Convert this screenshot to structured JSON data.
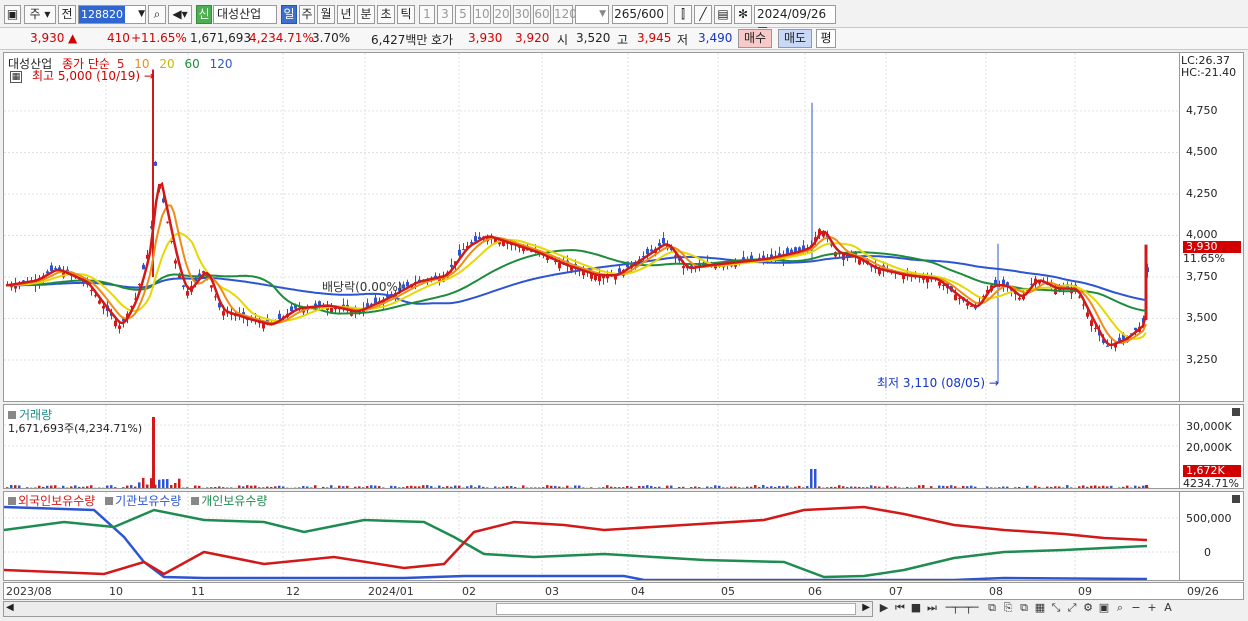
{
  "toolbar": {
    "market": "주",
    "prev_label": "전",
    "code": "128820",
    "stock_badge": "신",
    "stock_name": "대성산업",
    "periods": [
      "일",
      "주",
      "월",
      "년",
      "분",
      "초",
      "틱"
    ],
    "active_period": "일",
    "intervals": [
      "1",
      "3",
      "5",
      "10",
      "20",
      "30",
      "60",
      "120"
    ],
    "count": "265",
    "count_total": "/600",
    "date": "2024/09/26"
  },
  "quote": {
    "price": "3,930",
    "change": "410",
    "change_pct": "+11.65%",
    "volume": "1,671,693",
    "volume_ratio": "4,234.71%",
    "turnover_pct": "3.70%",
    "amount": "6,427백만",
    "ask_label": "호가",
    "ask": "3,930",
    "bid": "3,920",
    "open_label": "시",
    "open": "3,520",
    "high_label": "고",
    "high": "3,945",
    "low_label": "저",
    "low": "3,490",
    "buy_btn": "매수",
    "sell_btn": "매도",
    "eval_btn": "평"
  },
  "price_panel": {
    "legend_name": "대성산업",
    "legend_ma_label": "종가 단순",
    "ma_periods": [
      "5",
      "10",
      "20",
      "60",
      "120"
    ],
    "ma_colors": [
      "#d21919",
      "#f08c14",
      "#e6d800",
      "#1e8c3c",
      "#2d55d2"
    ],
    "high_annot": "최고 5,000 (10/19)",
    "low_annot": "최저 3,110 (08/05)",
    "dividend_annot": "배당락(0.00%)",
    "lc": "LC:26.37",
    "hc": "HC:-21.40",
    "axis_ticks": [
      "4,750",
      "4,500",
      "4,250",
      "4,000",
      "3,750",
      "3,500",
      "3,250"
    ],
    "current_tag": "3,930",
    "current_pct": "11.65%"
  },
  "volume_panel": {
    "title": "거래량",
    "value_line": "1,671,693주(4,234.71%)",
    "axis_ticks": [
      "30,000K",
      "20,000K"
    ],
    "current_tag": "1,672K",
    "current_pct": "4234.71%"
  },
  "holdings_panel": {
    "legend": [
      "외국인보유수량",
      "기관보유수량",
      "개인보유수량"
    ],
    "legend_colors": [
      "#d21919",
      "#2d55d2",
      "#1e8c50"
    ],
    "axis_ticks": [
      "500,000",
      "0"
    ]
  },
  "x_axis": {
    "labels": [
      "2023/08",
      "10",
      "11",
      "12",
      "2024/01",
      "02",
      "03",
      "04",
      "05",
      "06",
      "07",
      "08",
      "09",
      "09/26"
    ]
  },
  "chart_data": {
    "type": "line",
    "title": "",
    "description_series": [
      {
        "name": "종가",
        "x": [
          "2023/08",
          "2023/10",
          "2023/10/19",
          "2023/11",
          "2023/12",
          "2024/01",
          "2024/02",
          "2024/03",
          "2024/04",
          "2024/05",
          "2024/06",
          "2024/07",
          "2024/08",
          "2024/08/05",
          "2024/09",
          "2024/09/26"
        ],
        "values": [
          3700,
          3750,
          4600,
          3600,
          3480,
          3560,
          3960,
          3760,
          3880,
          3820,
          3950,
          3760,
          3600,
          3250,
          3360,
          3930
        ]
      }
    ],
    "ylim": [
      3110,
      5000
    ]
  }
}
